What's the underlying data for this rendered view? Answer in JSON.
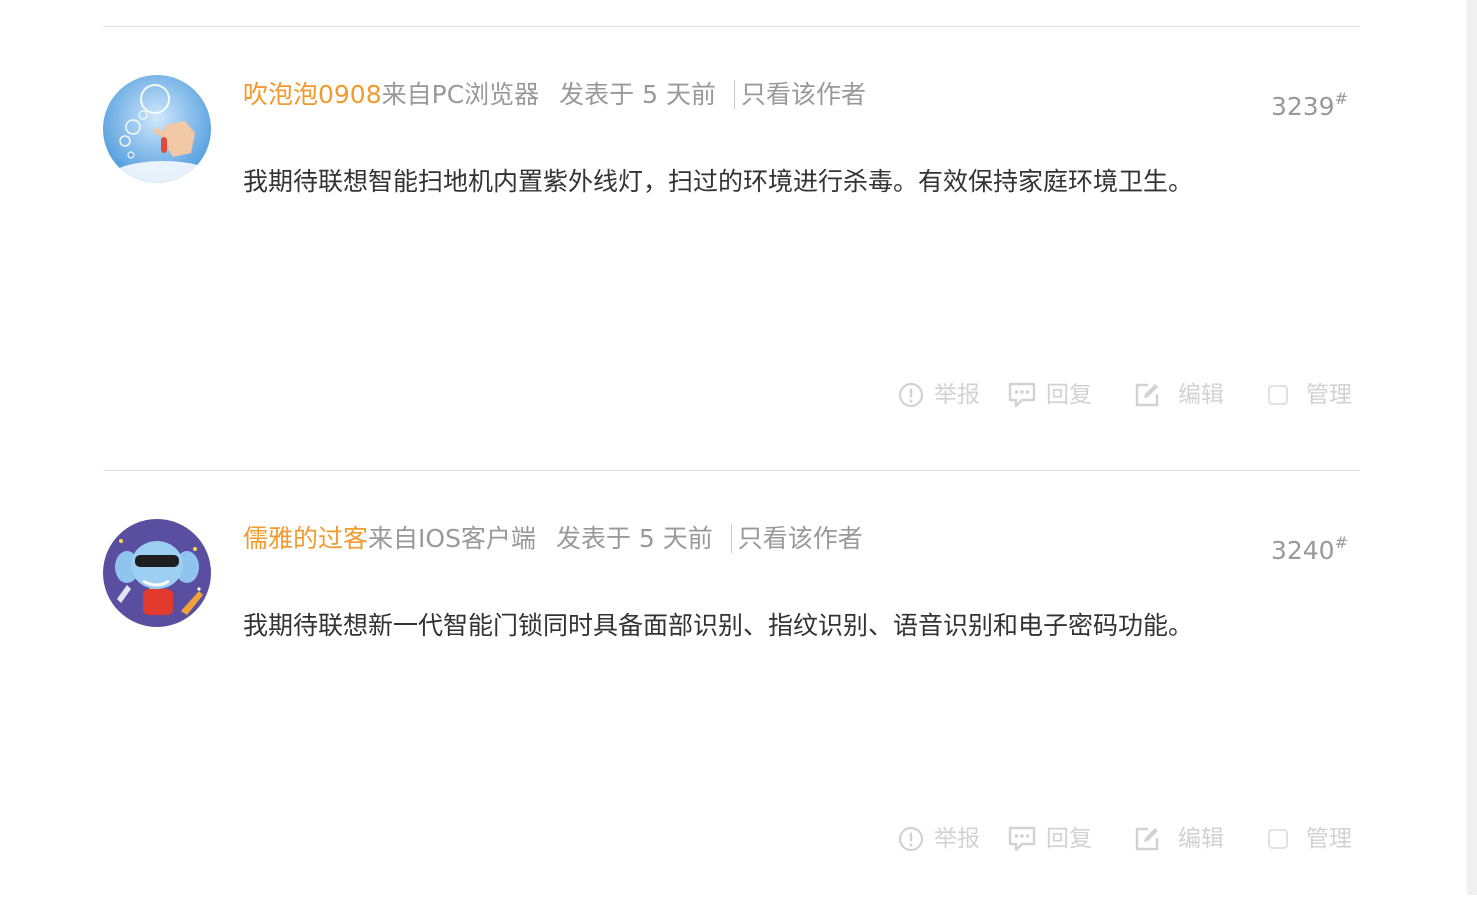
{
  "posts": [
    {
      "username": "吹泡泡0908",
      "source": "来自PC浏览器",
      "posted": "发表于 5 天前",
      "only_author": "只看该作者",
      "floor": "3239",
      "floor_mark": "#",
      "content": "我期待联想智能扫地机内置紫外线灯，扫过的环境进行杀毒。有效保持家庭环境卫生。",
      "avatar_icon": "bubble-blowing-avatar",
      "actions": {
        "report": "举报",
        "reply": "回复",
        "edit": "编辑",
        "manage": "管理"
      }
    },
    {
      "username": "儒雅的过客",
      "source": "来自IOS客户端",
      "posted": "发表于 5 天前",
      "only_author": "只看该作者",
      "floor": "3240",
      "floor_mark": "#",
      "content": "我期待联想新一代智能门锁同时具备面部识别、指纹识别、语音识别和电子密码功能。",
      "avatar_icon": "cartoon-elephant-avatar",
      "actions": {
        "report": "举报",
        "reply": "回复",
        "edit": "编辑",
        "manage": "管理"
      }
    }
  ],
  "colors": {
    "username": "#f29a2e",
    "meta": "#999999",
    "content": "#333333",
    "action": "#d2d2d2",
    "divider": "#e3e3e3"
  }
}
